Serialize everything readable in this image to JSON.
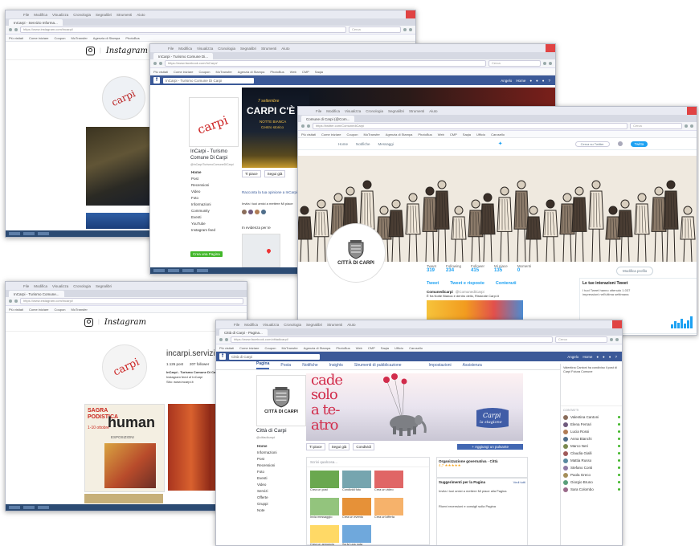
{
  "common": {
    "menu": [
      "File",
      "Modifica",
      "Visualizza",
      "Cronologia",
      "Segnalibri",
      "Strumenti",
      "Aiuto"
    ],
    "bookmarks": [
      "Più visitati",
      "Come iniziare",
      "Coupon",
      "MoTransfer",
      "Agenzia di Stampa",
      "PhotoBus",
      "Web",
      "CMP",
      "Saqia",
      "Ufficio",
      "Carosello",
      "Cittadini",
      "Modifica",
      "Agenzia comune",
      "Città di Carpi",
      "Pubblica",
      "Stampa",
      "Comune"
    ]
  },
  "win_ig1": {
    "tab": "InCarpi - Servizio Informa...",
    "url": "https://www.instagram.com/incarpi/",
    "search_placeholder": "Cerca",
    "brand": "Instagram"
  },
  "win_fb1": {
    "tab": "InCarpi - Turismo Comune Di...",
    "url": "https://www.facebook.com/InCarpi/",
    "search_placeholder": "Cerca",
    "fb_search": "InCarpi - Turismo Comune Di Carpi",
    "user": "Angelo",
    "home": "Home",
    "page_name": "InCarpi - Turismo Comune Di Carpi",
    "handle": "@InCarpiTurismoComuneDiCarpi",
    "menu": [
      "Home",
      "Post",
      "Recensioni",
      "Video",
      "Foto",
      "Informazioni",
      "Community",
      "Eventi",
      "YouTube",
      "Instagram feed"
    ],
    "create_page": "Crea una Pagina",
    "cover_top": "7 settembre",
    "cover_title": "CARPI C'È",
    "cover_sub1": "NOTTE BIANCA",
    "cover_sub2": "Centro storico",
    "like": "Ti piace",
    "following": "Segui già",
    "message": "Consigliato",
    "promo": "Racconta la tua opinione a InCarpi",
    "invite": "Invita i tuoi amici a mettere Mi piace",
    "near": "In evidenza per te"
  },
  "win_tw": {
    "tab": "Comune di Carpi (@Com...",
    "url": "https://twitter.com/ComunediCarpi",
    "search_placeholder": "Cerca",
    "nav": [
      "Home",
      "Notifiche",
      "Messaggi"
    ],
    "tw_search": "Cerca su Twitter",
    "tweet_btn": "Twitta",
    "stats": [
      {
        "label": "Tweet",
        "value": "319"
      },
      {
        "label": "Following",
        "value": "234"
      },
      {
        "label": "Follower",
        "value": "415"
      },
      {
        "label": "Mi piace",
        "value": "135"
      },
      {
        "label": "Momenti",
        "value": "0"
      }
    ],
    "edit_profile": "Modifica profilo",
    "logo_text": "CITTÀ DI CARPI",
    "profile_tabs": [
      "Tweet",
      "Tweet e risposte",
      "Contenuti"
    ],
    "account_name": "Comunedicarpi",
    "account_handle": "@ComunediCarpi",
    "tweet_line": "È fra Notte Bianca e dentro dello, Ristorate Carpi.it",
    "insights_title": "Le tue interazioni Tweet",
    "insights_text": "I tuoi Tweet hanno ottenuto 1.037 impressioni nell'ultima settimana",
    "insights_highlight": "1.037"
  },
  "win_ig2": {
    "tab": "InCarpi - Turismo Comune...",
    "url": "https://www.instagram.com/incarpi/",
    "search_placeholder": "Cerca",
    "brand": "Instagram",
    "username": "incarpi.servizi",
    "posts": "1.126 post",
    "followers": "207 follower",
    "bio_name": "InCarpi - Turismo Comune Di Carpi",
    "bio_line1": "Instagram feed of InCarpi",
    "bio_line2": "Sito: www.incarpi.it",
    "post1_title1": "SAGRA",
    "post1_title2": "PODISTICA",
    "post1_dates": "1-10 ottobre",
    "post1_big": "human",
    "post1_sub": "ESPOSIZIONI"
  },
  "win_fb2": {
    "tab": "Città di Carpi - Pagina...",
    "url": "https://www.facebook.com/cittadicarpi/",
    "search_placeholder": "Cerca",
    "fb_search": "Città di Carpi",
    "user": "Angelo",
    "home": "Home",
    "tabs": [
      "Pagina",
      "Posta",
      "Notifiche",
      "Insights",
      "Strumenti di pubblicazione"
    ],
    "tabs_right": [
      "Impostazioni",
      "Assistenza"
    ],
    "logo_text": "CITTÀ DI CARPI",
    "page_name": "Città di Carpi",
    "handle": "@cittadicarpi",
    "menu": [
      "Home",
      "Informazioni",
      "Post",
      "Recensioni",
      "Foto",
      "Eventi",
      "Video",
      "Servizi",
      "Offerte",
      "Gruppi",
      "Note"
    ],
    "cover_line1": "cade",
    "cover_line2": "solo",
    "cover_line3": "a te-",
    "cover_line4": "atro",
    "cover_sign1": "Carpi",
    "cover_sign2": "la stagione",
    "like": "Ti piace",
    "follow": "Segui già",
    "share": "Condividi",
    "add_button": "+ Aggiungi un pulsante",
    "composer": "Scrivi qualcosa...",
    "tiles": [
      {
        "label": "Crea un post",
        "color": "#6aa84f"
      },
      {
        "label": "Condividi foto",
        "color": "#76a5af"
      },
      {
        "label": "Crea un video",
        "color": "#e06666"
      },
      {
        "label": "Invia messaggio",
        "color": "#93c47d"
      },
      {
        "label": "Crea un evento",
        "color": "#e69138"
      },
      {
        "label": "Crea un'offerta",
        "color": "#f6b26b"
      },
      {
        "label": "Crea un annuncio",
        "color": "#ffd966"
      },
      {
        "label": "Scrivi una nota",
        "color": "#6fa8dc"
      }
    ],
    "org_title": "Organizzazione governativa · Città",
    "org_rating": "4,7 ★★★★★",
    "suggest_title": "Suggerimenti per la Pagina",
    "suggest_link": "Vedi tutti",
    "suggestions": [
      "Invita i tuoi amici a mettere Mi piace alla Pagina",
      "Ricevi recensioni e consigli sulla Pagina"
    ],
    "chat": [
      "Valentina Cantoni",
      "Elena Ferrari",
      "Lucia Rossi",
      "Anna Bianchi",
      "Marco Neri",
      "Claudia Gialli",
      "Mattia Russo",
      "Stefano Conti",
      "Paola Greco",
      "Giorgio Bruno",
      "Sara Colombo"
    ],
    "chat_header": "CONTATTI",
    "ticker": "Valentina Cantoni ha condiviso il post di Carpi Futura Comune"
  }
}
